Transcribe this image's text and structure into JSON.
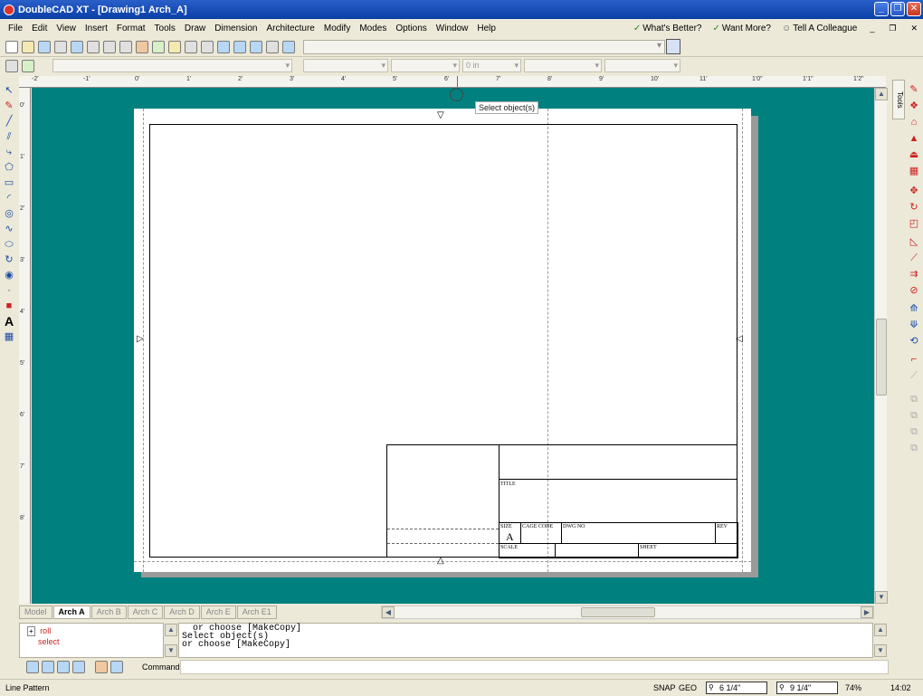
{
  "window": {
    "title": "DoubleCAD XT - [Drawing1 Arch_A]"
  },
  "menu": {
    "items": [
      "File",
      "Edit",
      "View",
      "Insert",
      "Format",
      "Tools",
      "Draw",
      "Dimension",
      "Architecture",
      "Modify",
      "Modes",
      "Options",
      "Window",
      "Help"
    ],
    "right": [
      "What's Better?",
      "Want More?",
      "Tell A Colleague"
    ]
  },
  "toolbar": {
    "length_field": "0 in"
  },
  "ruler": {
    "top_ticks": [
      "-2'",
      "-1'",
      "0'",
      "1'",
      "2'",
      "3'",
      "4'",
      "5'",
      "6'",
      "7'",
      "8'",
      "9'",
      "10'",
      "11'",
      "1'0\"",
      "1'1\"",
      "1'2\""
    ],
    "left_ticks": [
      "0'",
      "1'",
      "2'",
      "3'",
      "4'",
      "5'",
      "6'",
      "7'",
      "8'"
    ]
  },
  "canvas": {
    "tooltip": "Select object(s)",
    "title_block": {
      "title_label": "TITLE",
      "size_label": "SIZE",
      "size_value": "A",
      "cage_label": "CAGE CODE",
      "dwg_label": "DWG NO",
      "rev_label": "REV",
      "scale_label": "SCALE",
      "sheet_label": "SHEET"
    }
  },
  "tabs": [
    "Model",
    "Arch A",
    "Arch B",
    "Arch C",
    "Arch D",
    "Arch E",
    "Arch E1"
  ],
  "active_tab": "Arch A",
  "right_panel": {
    "tab_label": "Tools"
  },
  "command": {
    "history": [
      "roll",
      "select"
    ],
    "output_lines": [
      "  or choose [MakeCopy]",
      "Select object(s)",
      "or choose [MakeCopy]"
    ],
    "input_label": "Command"
  },
  "status": {
    "left": "Line Pattern",
    "snap": "SNAP",
    "geo": "GEO",
    "x": "6 1/4\"",
    "y": "9 1/4\"",
    "zoom": "74%",
    "time": "14:02"
  }
}
